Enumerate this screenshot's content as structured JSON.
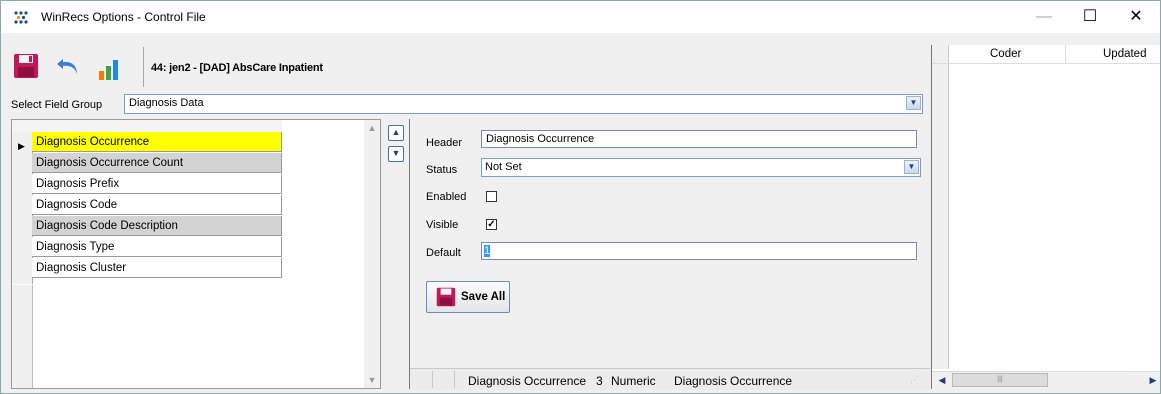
{
  "window": {
    "title": "WinRecs Options - Control File",
    "minimize_glyph": "—",
    "maximize_glyph": "☐",
    "close_glyph": "✕"
  },
  "toolbar": {
    "record_title": "44: jen2 - [DAD] AbsCare Inpatient",
    "icons": [
      "save-icon",
      "undo-icon",
      "chart-icon"
    ]
  },
  "field_group": {
    "label": "Select Field Group",
    "selected": "Diagnosis Data"
  },
  "fields_list": {
    "items": [
      "Diagnosis Occurrence",
      "Diagnosis Occurrence Count",
      "Diagnosis Prefix",
      "Diagnosis Code",
      "Diagnosis Code Description",
      "Diagnosis Type",
      "Diagnosis Cluster"
    ],
    "selected_index": 0,
    "highlight_color": "#ffff00",
    "alt_color": "#d3d3d3"
  },
  "details": {
    "header_label": "Header",
    "header_value": "Diagnosis Occurrence",
    "status_label": "Status",
    "status_value": "Not Set",
    "enabled_label": "Enabled",
    "enabled_checked": false,
    "visible_label": "Visible",
    "visible_checked": true,
    "default_label": "Default",
    "default_value": "1",
    "save_label": "Save All"
  },
  "status_bar": {
    "field_name": "Diagnosis Occurrence",
    "field_length": "3",
    "field_type": "Numeric",
    "field_description": "Diagnosis Occurrence"
  },
  "right_grid": {
    "columns": [
      "Coder",
      "Updated"
    ]
  }
}
